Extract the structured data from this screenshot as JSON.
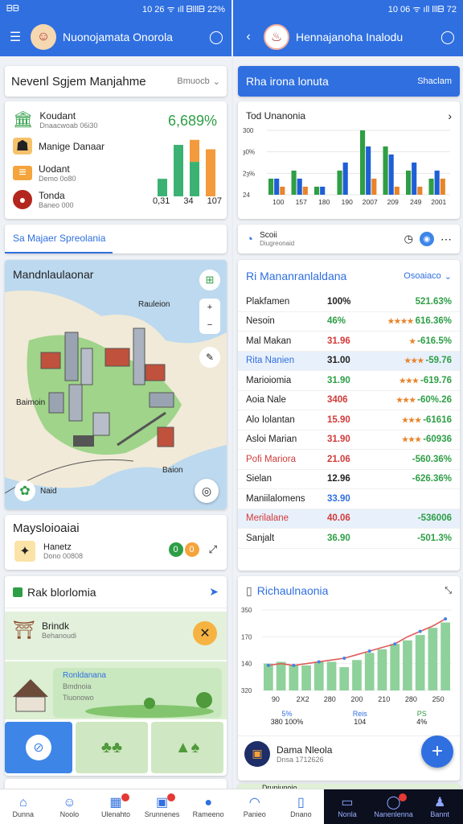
{
  "left": {
    "status": {
      "left": "ᗷᗷ",
      "right": "10 26 ᯤ ıll ᗷlllᗷ 22%"
    },
    "appbar": {
      "title": "Nuonojamata Onorola"
    },
    "system_card": {
      "title": "Nevenl Sgjem Manjahme",
      "dropdown": "Bmuocb",
      "items": [
        {
          "label": "Koudant",
          "sub": "Dnaacwoab 06i30",
          "icon": "bank-icon"
        },
        {
          "label": "Manige Danaar",
          "sub": "",
          "icon": "person-icon"
        },
        {
          "label": "Uodant",
          "sub": "Demo 0o80",
          "icon": "document-icon"
        },
        {
          "label": "Tonda",
          "sub": "Baneo 000",
          "icon": "avatar-icon"
        }
      ],
      "percent": "6,689%",
      "bars": [
        {
          "green": 0.28,
          "orange": 0
        },
        {
          "green": 0.82,
          "orange": 0
        },
        {
          "green": 0.55,
          "orange": 0.35
        },
        {
          "green": 0,
          "orange": 0.75
        }
      ],
      "bar_labels": [
        "0,31",
        "34",
        "107"
      ]
    },
    "tab": {
      "label": "Sa Majaer Spreolania"
    },
    "map_card": {
      "title": "Mandnlaulaonar",
      "label_top": "Rauleion",
      "label_left": "Baimoin",
      "label_bottom": "Baion",
      "label_badge": "Naid"
    },
    "mayst_card": {
      "title": "Maysloioaiai",
      "label": "Hanetz",
      "sub": "Dono 00808",
      "badge1": "0",
      "badge2": "0"
    },
    "rak_card": {
      "title": "Rak blorlomia",
      "item_title": "Brindk",
      "item_sub": "Behanoudi",
      "green_title": "Ronldanana",
      "green_sub": "Bmdnoia",
      "green_sub2": "Tiuonowo"
    }
  },
  "right": {
    "status": {
      "right": "10 06 ᯤ ıll lllᗷ 72"
    },
    "appbar": {
      "title": "Hennajanoha Inalodu"
    },
    "tab_card": {
      "title": "Rha irona lonuta",
      "right": "Shaclam"
    },
    "chart_card": {
      "title": "Tod Unanonia",
      "chart_data": {
        "type": "bar",
        "categories": [
          "100",
          "157",
          "180",
          "190",
          "2007",
          "209",
          "249",
          "2001"
        ],
        "series": [
          {
            "color": "#2f9e44",
            "values": [
              2,
              3,
              1,
              3,
              8,
              6,
              3,
              2
            ]
          },
          {
            "color": "#1f5fd6",
            "values": [
              2,
              2,
              1,
              4,
              6,
              5,
              4,
              3
            ]
          },
          {
            "color": "#e8842a",
            "values": [
              1,
              1,
              0,
              0,
              2,
              1,
              1,
              2
            ]
          }
        ],
        "y_ticks": [
          "300",
          "ȝ0%",
          "2ȝ%",
          "24"
        ]
      }
    },
    "info_row": {
      "label": "Scoii",
      "sub": "Diugreonaid"
    },
    "stock_card": {
      "title": "Ri Mananranlaldana",
      "dropdown": "Osoaiaco",
      "rows": [
        {
          "name": "Plakfamen",
          "value": "100%",
          "change": "521.63%",
          "stars": "",
          "name_color": "#222",
          "value_color": "#222",
          "change_color": "#2e9e46",
          "hl": false
        },
        {
          "name": "Nesoin",
          "value": "46%",
          "change": "616.36%",
          "stars": "★★★★",
          "name_color": "#222",
          "value_color": "#2e9e46",
          "change_color": "#2e9e46",
          "hl": false
        },
        {
          "name": "Mal Makan",
          "value": "31.96",
          "change": "-616.5%",
          "stars": "★",
          "name_color": "#222",
          "value_color": "#d23a3a",
          "change_color": "#2e9e46",
          "hl": false
        },
        {
          "name": "Rita Nanien",
          "value": "31.00",
          "change": "-59.76",
          "stars": "★★★",
          "name_color": "#2f6fe0",
          "value_color": "#222",
          "change_color": "#2e9e46",
          "hl": true
        },
        {
          "name": "Marioiomia",
          "value": "31.90",
          "change": "-619.76",
          "stars": "★★★",
          "name_color": "#222",
          "value_color": "#2e9e46",
          "change_color": "#2e9e46",
          "hl": false
        },
        {
          "name": "Aoia Nale",
          "value": "3406",
          "change": "-60%.26",
          "stars": "★★★",
          "name_color": "#222",
          "value_color": "#d23a3a",
          "change_color": "#2e9e46",
          "hl": false
        },
        {
          "name": "Alo Iolantan",
          "value": "15.90",
          "change": "-61616",
          "stars": "★★★",
          "name_color": "#222",
          "value_color": "#d23a3a",
          "change_color": "#2e9e46",
          "hl": false
        },
        {
          "name": "Asloi Marian",
          "value": "31.90",
          "change": "-60936",
          "stars": "★★★",
          "name_color": "#222",
          "value_color": "#d23a3a",
          "change_color": "#2e9e46",
          "hl": false
        },
        {
          "name": "Pofi Mariora",
          "value": "21.06",
          "change": "-560.36%",
          "stars": "",
          "name_color": "#d23a3a",
          "value_color": "#d23a3a",
          "change_color": "#2e9e46",
          "hl": false
        },
        {
          "name": "Sielan",
          "value": "12.96",
          "change": "-626.36%",
          "stars": "",
          "name_color": "#222",
          "value_color": "#222",
          "change_color": "#2e9e46",
          "hl": false
        },
        {
          "name": "Maniilalomens",
          "value": "33.90",
          "change": "",
          "stars": "",
          "name_color": "#222",
          "value_color": "#2f6fe0",
          "change_color": "#2e9e46",
          "hl": false
        },
        {
          "name": "Merilalane",
          "value": "40.06",
          "change": "-536006",
          "stars": "",
          "name_color": "#d23a3a",
          "value_color": "#d23a3a",
          "change_color": "#2e9e46",
          "hl": true
        },
        {
          "name": "Sanjalt",
          "value": "36.90",
          "change": "-501.3%",
          "stars": "",
          "name_color": "#222",
          "value_color": "#2e9e46",
          "change_color": "#2e9e46",
          "hl": false
        }
      ]
    },
    "growth_card": {
      "title": "Richaulnaonia",
      "chart_data": {
        "type": "bar",
        "categories": [
          "90",
          "2X2",
          "280",
          "200",
          "210",
          "280",
          "250"
        ],
        "values": [
          30,
          32,
          28,
          28,
          32,
          32,
          26,
          34,
          42,
          46,
          52,
          56,
          62,
          70,
          76
        ],
        "line": [
          28,
          30,
          28,
          30,
          32,
          34,
          36,
          40,
          44,
          48,
          52,
          60,
          66,
          72,
          80
        ],
        "y_ticks": [
          "350",
          "170",
          "140",
          "320"
        ],
        "legend": [
          "5%",
          "Reis",
          "PS"
        ],
        "legend_sub": [
          "380 100%",
          "104",
          "4%"
        ]
      }
    },
    "fab_row": {
      "name": "Dama Nleola",
      "sub": "Dnsa 1712626"
    },
    "bottom_peek": "Druniunoio"
  },
  "navbar": {
    "items": [
      {
        "label": "Dunna",
        "icon": "home-icon",
        "dark": false,
        "badge": false
      },
      {
        "label": "Noolo",
        "icon": "people-icon",
        "dark": false,
        "badge": false
      },
      {
        "label": "Ulenahto",
        "icon": "calendar-icon",
        "dark": false,
        "badge": true
      },
      {
        "label": "Srunnenes",
        "icon": "wallet-icon",
        "dark": false,
        "badge": true
      },
      {
        "label": "Rameeno",
        "icon": "profile-icon",
        "dark": false,
        "badge": false
      },
      {
        "label": "Panieo",
        "icon": "bell-icon",
        "dark": false,
        "badge": false
      },
      {
        "label": "Dnano",
        "icon": "file-icon",
        "dark": false,
        "badge": false
      },
      {
        "label": "Nonla",
        "icon": "monitor-icon",
        "dark": true,
        "badge": false
      },
      {
        "label": "Nanenlenna",
        "icon": "chat-icon",
        "dark": true,
        "badge": true
      },
      {
        "label": "Bannt",
        "icon": "user-icon",
        "dark": true,
        "badge": false
      }
    ]
  }
}
